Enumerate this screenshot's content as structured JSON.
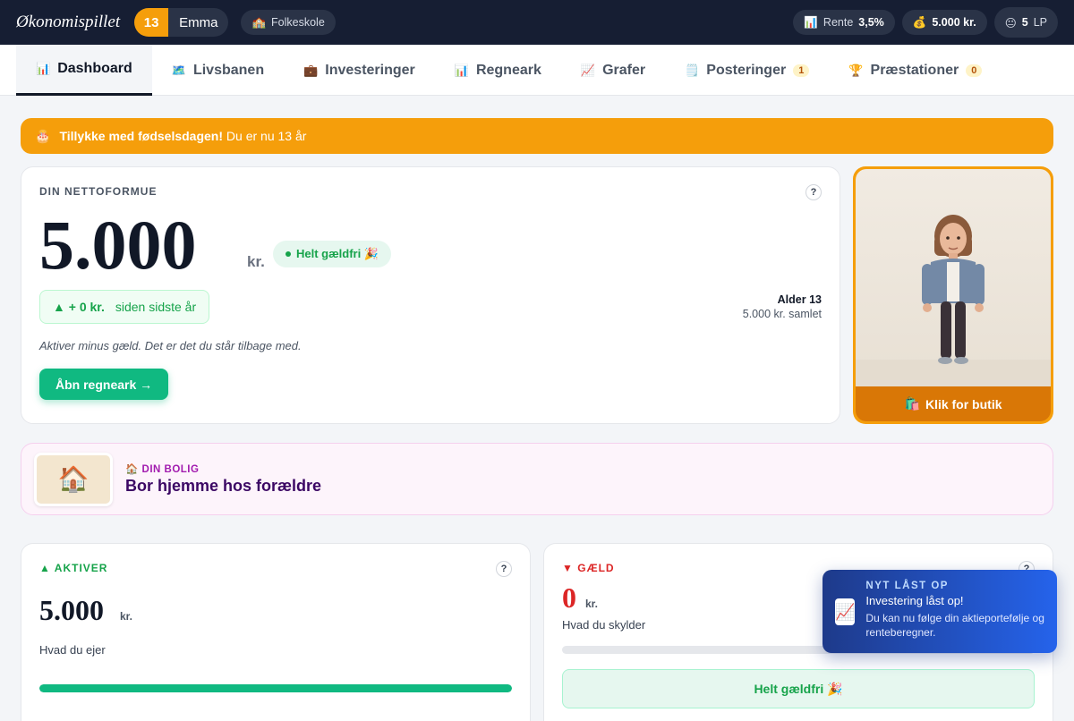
{
  "topbar": {
    "brand": "Økonomispillet",
    "age": "13",
    "player_name": "Emma",
    "school_icon": "school-icon",
    "school": "Folkeskole",
    "rate_label": "Rente",
    "rate_value": "3,5%",
    "money": "5.000 kr.",
    "lp_value": "5",
    "lp_label": "LP"
  },
  "tabs": [
    {
      "label": "Dashboard",
      "icon": "bar-chart-icon",
      "active": true
    },
    {
      "label": "Livsbanen",
      "icon": "map-icon"
    },
    {
      "label": "Investeringer",
      "icon": "briefcase-icon"
    },
    {
      "label": "Regneark",
      "icon": "spreadsheet-icon"
    },
    {
      "label": "Grafer",
      "icon": "line-chart-icon"
    },
    {
      "label": "Posteringer",
      "icon": "ledger-icon",
      "badge": "1"
    },
    {
      "label": "Præstationer",
      "icon": "trophy-icon",
      "badge": "0"
    }
  ],
  "birthday": {
    "bold": "Tillykke med fødselsdagen!",
    "text": "Du er nu 13 år"
  },
  "networth": {
    "label": "DIN NETTOFORMUE",
    "value": "5.000",
    "unit": "kr.",
    "status": "Helt gældfri 🎉",
    "change_value": "+ 0 kr.",
    "change_label": "siden sidste år",
    "age_label": "Alder 13",
    "total": "5.000 kr. samlet",
    "explanation": "Aktiver minus gæld. Det er det du står tilbage med.",
    "button": "Åbn regneark →"
  },
  "avatar": {
    "shop_button": "Klik for butik"
  },
  "home": {
    "label": "DIN BOLIG",
    "value": "Bor hjemme hos forældre"
  },
  "assets": {
    "title": "AKTIVER",
    "value": "5.000",
    "unit": "kr.",
    "description": "Hvad du ejer",
    "bar_fraction": 1.0
  },
  "debt": {
    "title": "GÆLD",
    "value": "0",
    "unit": "kr.",
    "description": "Hvad du skylder",
    "status": "Helt gældfri 🎉"
  },
  "toast": {
    "kicker": "NYT LÅST OP",
    "title": "Investering låst op!",
    "body": "Du kan nu følge din aktieportefølje og renteberegner."
  },
  "colors": {
    "topbar": "#161e33",
    "accent_orange": "#f59e0b",
    "accent_green": "#10b981",
    "debt_red": "#dc2626",
    "toast_blue": "#2563eb"
  }
}
